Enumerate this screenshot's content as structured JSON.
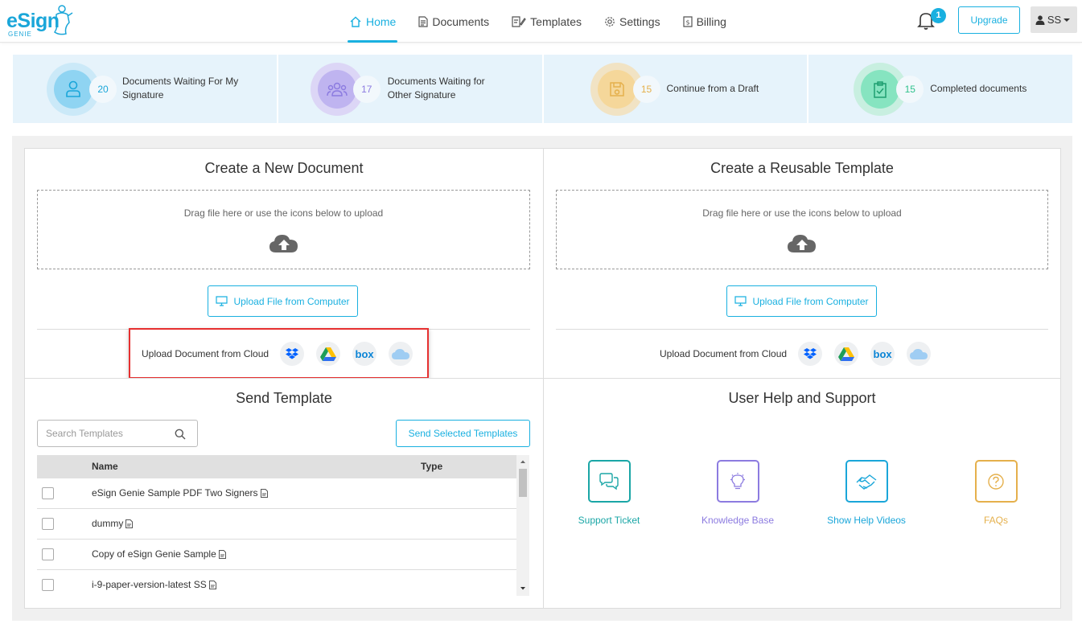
{
  "brand": {
    "name": "eSign",
    "sub": "GENIE",
    "color": "#1aa6d9"
  },
  "nav": [
    {
      "label": "Home",
      "icon": "home-icon",
      "active": true
    },
    {
      "label": "Documents",
      "icon": "document-icon"
    },
    {
      "label": "Templates",
      "icon": "template-icon"
    },
    {
      "label": "Settings",
      "icon": "gear-icon"
    },
    {
      "label": "Billing",
      "icon": "billing-icon"
    }
  ],
  "header": {
    "notifications": "1",
    "upgrade_label": "Upgrade",
    "user_initials": "SS"
  },
  "stats": [
    {
      "count": "20",
      "label_line1": "Documents Waiting For My",
      "label_line2": "Signature",
      "icon": "user-icon",
      "color": "#1aa6d9"
    },
    {
      "count": "17",
      "label_line1": "Documents Waiting for",
      "label_line2": "Other Signature",
      "icon": "users-icon",
      "color": "#8c7be0"
    },
    {
      "count": "15",
      "label_line1": "Continue from a Draft",
      "label_line2": "",
      "icon": "save-icon",
      "color": "#e5b04c"
    },
    {
      "count": "15",
      "label_line1": "Completed documents",
      "label_line2": "",
      "icon": "clipboard-check-icon",
      "color": "#2fc18c"
    }
  ],
  "new_document": {
    "title": "Create a New Document",
    "drop_hint": "Drag file here or use the icons below to upload",
    "upload_label": "Upload File from Computer",
    "cloud_label": "Upload Document from Cloud"
  },
  "reusable_template": {
    "title": "Create a Reusable Template",
    "drop_hint": "Drag file here or use the icons below to upload",
    "upload_label": "Upload File from Computer",
    "cloud_label": "Upload Document from Cloud"
  },
  "cloud_services": [
    "dropbox-icon",
    "google-drive-icon",
    "box-icon",
    "icloud-icon"
  ],
  "cloud_box_text": "box",
  "send_template": {
    "title": "Send Template",
    "search_placeholder": "Search Templates",
    "send_label": "Send Selected Templates",
    "columns": [
      "Name",
      "Type"
    ],
    "rows": [
      {
        "name": "eSign Genie Sample PDF Two Signers"
      },
      {
        "name": "dummy"
      },
      {
        "name": "Copy of eSign Genie Sample"
      },
      {
        "name": "i-9-paper-version-latest SS"
      }
    ]
  },
  "help": {
    "title": "User Help and Support",
    "items": [
      {
        "label": "Support Ticket",
        "color": "#1aa6a6"
      },
      {
        "label": "Knowledge Base",
        "color": "#8c7be0"
      },
      {
        "label": "Show Help Videos",
        "color": "#1aa6d9"
      },
      {
        "label": "FAQs",
        "color": "#e5b04c"
      }
    ]
  }
}
